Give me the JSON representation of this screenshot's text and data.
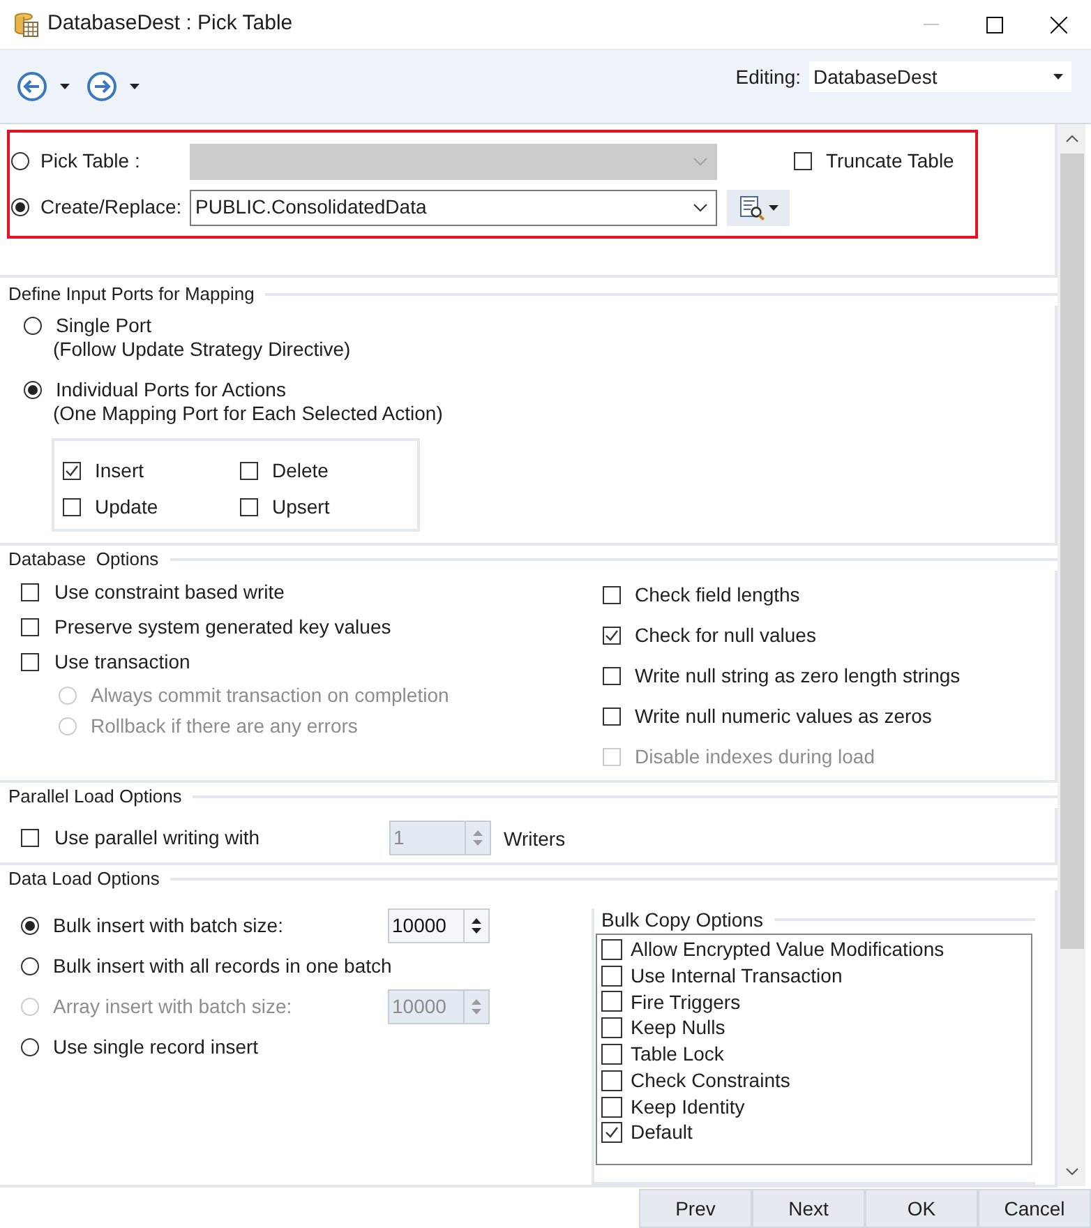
{
  "window": {
    "title": "DatabaseDest : Pick Table"
  },
  "toolbar": {
    "editing_label": "Editing:",
    "editing_value": "DatabaseDest"
  },
  "table_choice": {
    "options": [
      {
        "label": "Pick Table :",
        "selected": false,
        "field_disabled": true
      },
      {
        "label": "Create/Replace:",
        "selected": true,
        "field_disabled": false,
        "value": "PUBLIC.ConsolidatedData"
      }
    ],
    "truncate": {
      "label": "Truncate Table",
      "checked": false
    }
  },
  "input_ports": {
    "title": "Define Input Ports for Mapping",
    "options": [
      {
        "label": "Single Port",
        "note": "(Follow Update Strategy Directive)",
        "selected": false
      },
      {
        "label": "Individual Ports for Actions",
        "note": "(One Mapping Port for Each Selected Action)",
        "selected": true
      }
    ],
    "actions": [
      {
        "label": "Insert",
        "checked": true
      },
      {
        "label": "Delete",
        "checked": false
      },
      {
        "label": "Update",
        "checked": false
      },
      {
        "label": "Upsert",
        "checked": false
      }
    ]
  },
  "database_options": {
    "title": "Database  Options",
    "left": [
      {
        "label": "Use constraint based write",
        "checked": false
      },
      {
        "label": "Preserve system generated key values",
        "checked": false
      },
      {
        "label": "Use transaction",
        "checked": false,
        "children": [
          {
            "label": "Always commit transaction on completion",
            "selected": false,
            "disabled": true
          },
          {
            "label": "Rollback if there are any errors",
            "selected": false,
            "disabled": true
          }
        ]
      }
    ],
    "right": [
      {
        "label": "Check field lengths",
        "checked": false,
        "disabled": false
      },
      {
        "label": "Check for null values",
        "checked": true,
        "disabled": false
      },
      {
        "label": "Write null string as zero length strings",
        "checked": false,
        "disabled": false
      },
      {
        "label": "Write null numeric values as zeros",
        "checked": false,
        "disabled": false
      },
      {
        "label": "Disable indexes during load",
        "checked": false,
        "disabled": true
      }
    ]
  },
  "parallel_load": {
    "title": "Parallel Load Options",
    "label": "Use parallel writing with",
    "checked": false,
    "writers": "1",
    "writers_disabled": true,
    "suffix": "Writers"
  },
  "data_load": {
    "title": "Data Load Options",
    "options": [
      {
        "label": "Bulk insert with batch size:",
        "selected": true,
        "disabled": false,
        "batch_size": "10000"
      },
      {
        "label": "Bulk insert with all records in one batch",
        "selected": false,
        "disabled": false
      },
      {
        "label": "Array insert with batch size:",
        "selected": false,
        "disabled": true,
        "batch_size": "10000"
      },
      {
        "label": "Use single record insert",
        "selected": false,
        "disabled": false
      }
    ],
    "bulk_copy": {
      "title": "Bulk Copy Options",
      "items": [
        {
          "label": "Allow Encrypted Value Modifications",
          "checked": false
        },
        {
          "label": "Use Internal Transaction",
          "checked": false
        },
        {
          "label": "Fire Triggers",
          "checked": false
        },
        {
          "label": "Keep Nulls",
          "checked": false
        },
        {
          "label": "Table Lock",
          "checked": false
        },
        {
          "label": "Check Constraints",
          "checked": false
        },
        {
          "label": "Keep Identity",
          "checked": false
        },
        {
          "label": "Default",
          "checked": true
        }
      ]
    }
  },
  "buttons": [
    {
      "label": "Prev"
    },
    {
      "label": "Next"
    },
    {
      "label": "OK"
    },
    {
      "label": "Cancel"
    }
  ]
}
